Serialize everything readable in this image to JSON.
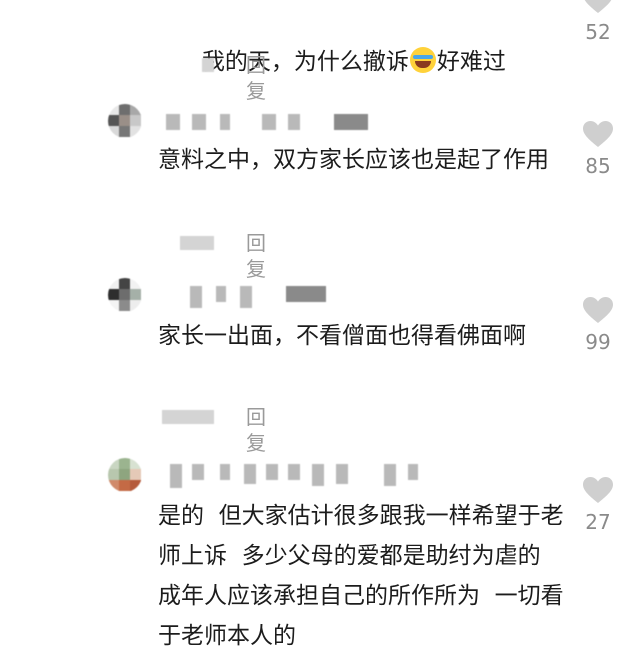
{
  "colors": {
    "text": "#1c1c1c",
    "muted": "#9a9a9a",
    "like_outline": "#cfcfcf",
    "background": "#ffffff"
  },
  "comments": [
    {
      "text_before_emoji": "我的天，为什么撤诉",
      "emoji": "rofl-emoji",
      "text_after_emoji": "好难过",
      "reply_label": "回复",
      "likes": "52"
    },
    {
      "text": "意料之中，双方家长应该也是起了作用",
      "reply_label": "回复",
      "likes": "85"
    },
    {
      "text": "家长一出面，不看僧面也得看佛面啊",
      "reply_label": "回复",
      "likes": "99"
    },
    {
      "text": "是的  但大家估计很多跟我一样希望于老师上诉  多少父母的爱都是助纣为虐的  成年人应该承担自己的所作所为  一切看于老师本人的",
      "likes": "27"
    }
  ]
}
